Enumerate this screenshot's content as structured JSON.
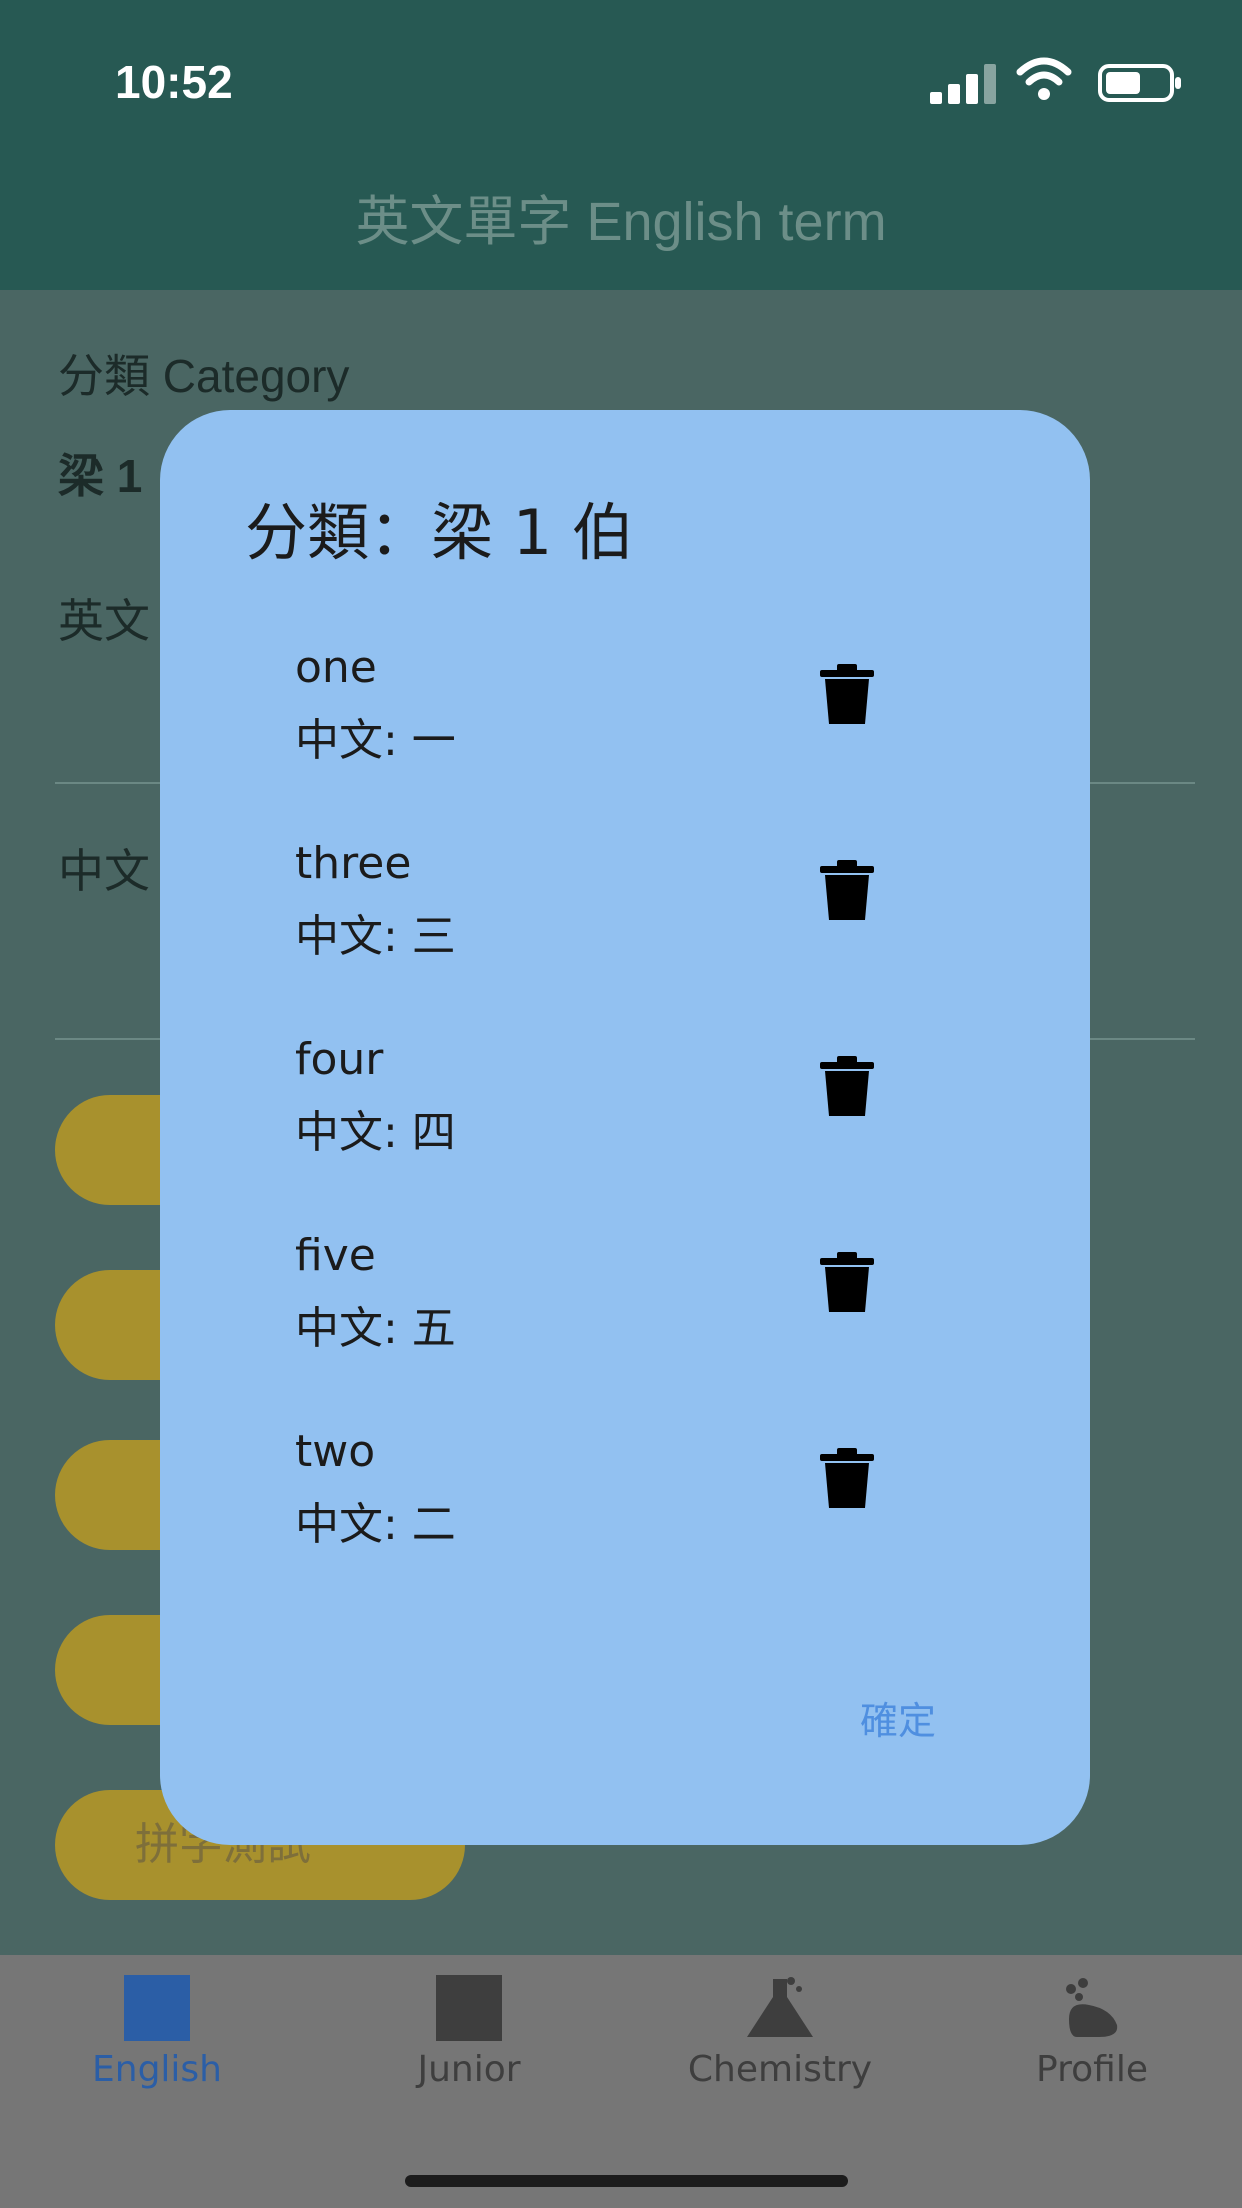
{
  "status_bar": {
    "time": "10:52"
  },
  "header": {
    "title": "英文單字 English term"
  },
  "background": {
    "category_label": "分類 Category",
    "category_value_partial": "梁 1",
    "english_label_partial": "英文",
    "chinese_label_partial": "中文",
    "spelling_test_button_partial": "拼字測試"
  },
  "dialog": {
    "title": "分類：梁 1 伯",
    "words": [
      {
        "english": "one",
        "chinese": "中文: 一"
      },
      {
        "english": "three",
        "chinese": "中文: 三"
      },
      {
        "english": "four",
        "chinese": "中文: 四"
      },
      {
        "english": "five",
        "chinese": "中文: 五"
      },
      {
        "english": "two",
        "chinese": "中文: 二"
      }
    ],
    "confirm_label": "確定"
  },
  "tabs": [
    {
      "label": "English",
      "icon": "square-icon",
      "active": true
    },
    {
      "label": "Junior",
      "icon": "square-icon",
      "active": false
    },
    {
      "label": "Chemistry",
      "icon": "flask-icon",
      "active": false
    },
    {
      "label": "Profile",
      "icon": "footprint-icon",
      "active": false
    }
  ],
  "colors": {
    "header": "#275953",
    "dialog": "#92c1f1",
    "accent_button": "#a8912d",
    "active_tab": "#2b5ea6",
    "confirm": "#4f8fe0"
  }
}
